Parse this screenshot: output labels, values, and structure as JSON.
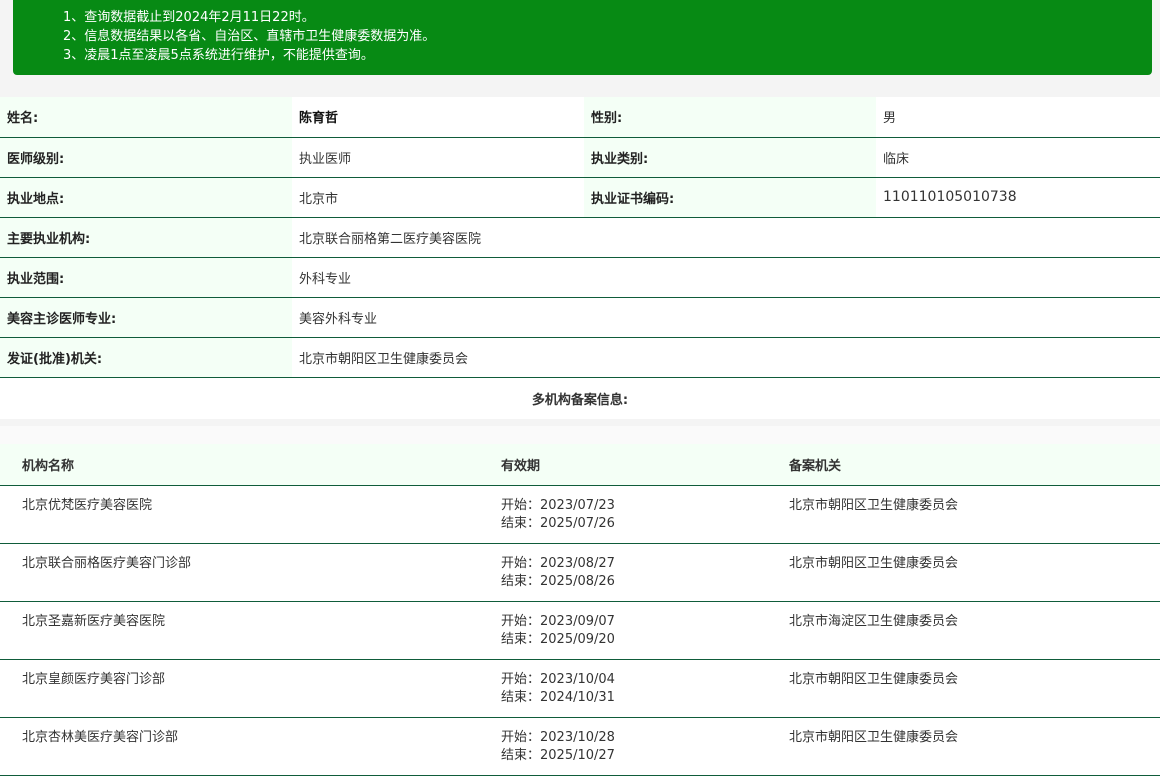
{
  "notice": {
    "lines": [
      "1、查询数据截止到2024年2月11日22时。",
      "2、信息数据结果以各省、自治区、直辖市卫生健康委数据为准。",
      "3、凌晨1点至凌晨5点系统进行维护，不能提供查询。"
    ]
  },
  "info": {
    "name_label": "姓名:",
    "name": "陈育哲",
    "gender_label": "性别:",
    "gender": "男",
    "level_label": "医师级别:",
    "level": "执业医师",
    "category_label": "执业类别:",
    "category": "临床",
    "location_label": "执业地点:",
    "location": "北京市",
    "cert_label": "执业证书编码:",
    "cert": "110110105010738",
    "institution_label": "主要执业机构:",
    "institution": "北京联合丽格第二医疗美容医院",
    "scope_label": "执业范围:",
    "scope": "外科专业",
    "specialty_label": "美容主诊医师专业:",
    "specialty": "美容外科专业",
    "issuer_label": "发证(批准)机关:",
    "issuer": "北京市朝阳区卫生健康委员会",
    "multi_title": "多机构备案信息:"
  },
  "records": {
    "headers": [
      "机构名称",
      "有效期",
      "备案机关"
    ],
    "rows": [
      {
        "name": "北京优梵医疗美容医院",
        "start": "开始：2023/07/23",
        "end": "结束：2025/07/26",
        "authority": "北京市朝阳区卫生健康委员会"
      },
      {
        "name": "北京联合丽格医疗美容门诊部",
        "start": "开始：2023/08/27",
        "end": "结束：2025/08/26",
        "authority": "北京市朝阳区卫生健康委员会"
      },
      {
        "name": "北京圣嘉新医疗美容医院",
        "start": "开始：2023/09/07",
        "end": "结束：2025/09/20",
        "authority": "北京市海淀区卫生健康委员会"
      },
      {
        "name": "北京皇颜医疗美容门诊部",
        "start": "开始：2023/10/04",
        "end": "结束：2024/10/31",
        "authority": "北京市朝阳区卫生健康委员会"
      },
      {
        "name": "北京杏林美医疗美容门诊部",
        "start": "开始：2023/10/28",
        "end": "结束：2025/10/27",
        "authority": "北京市朝阳区卫生健康委员会"
      }
    ]
  }
}
